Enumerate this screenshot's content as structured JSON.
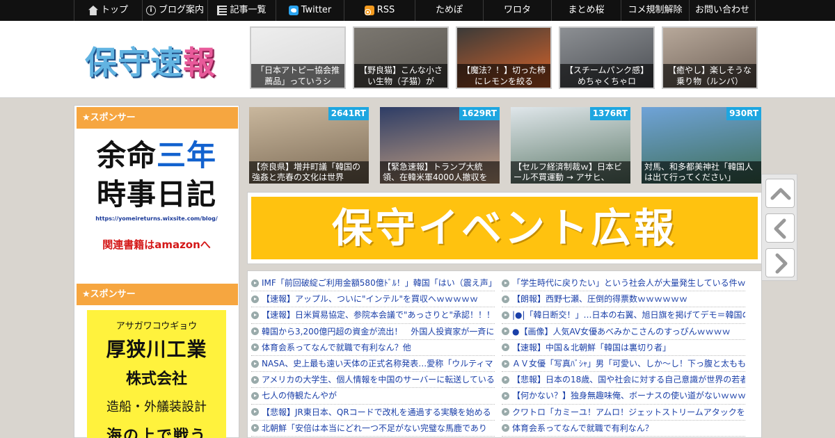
{
  "nav": {
    "items": [
      {
        "label": "トップ",
        "icon": "home-icon"
      },
      {
        "label": "ブログ案内",
        "icon": "info-icon"
      },
      {
        "label": "記事一覧",
        "icon": "list-icon"
      },
      {
        "label": "Twitter",
        "icon": "twitter-icon"
      },
      {
        "label": "RSS",
        "icon": "rss-icon"
      },
      {
        "label": "ためぽ",
        "icon": ""
      },
      {
        "label": "ワロタ",
        "icon": ""
      },
      {
        "label": "まとめ桜",
        "icon": ""
      },
      {
        "label": "コメ規制解除",
        "icon": ""
      },
      {
        "label": "お問い合わせ",
        "icon": ""
      }
    ]
  },
  "header": {
    "logo_part1": "保守",
    "logo_part2": "速",
    "logo_part3": "報",
    "thumbs": [
      {
        "caption": "「日本アトピー協会推薦品」っていうシ",
        "colors": [
          "#eeeeee",
          "#d8d8d8"
        ]
      },
      {
        "caption": "【野良猫】こんな小さい生物（子猫）が",
        "colors": [
          "#7b7770",
          "#5a5650"
        ]
      },
      {
        "caption": "【魔法？！】切った柿にレモンを絞る",
        "colors": [
          "#3b3a38",
          "#d9642a"
        ]
      },
      {
        "caption": "【スチームパンク感】めちゃくちゃロ",
        "colors": [
          "#8c8f93",
          "#4a4d52"
        ]
      },
      {
        "caption": "【癒やし】楽しそうな乗り物（ルンバ）",
        "colors": [
          "#b7a89a",
          "#6d5f55"
        ]
      }
    ]
  },
  "sidebar": {
    "sponsor_label_1": "★スポンサー",
    "sponsor_label_2": "★スポンサー",
    "ad1": {
      "line1a": "余命",
      "line1b": "三年",
      "line2": "時事日記",
      "url": "https://yomeireturns.wixsite.com/blog/",
      "link": "関連書籍はamazonへ"
    },
    "ad2": {
      "kana": "アサガワコウギョウ",
      "name": "厚狭川工業",
      "company": "株式会社",
      "desc": "造船・外艤装設計",
      "tag": "海の上で戦う"
    }
  },
  "ranking": [
    {
      "rt": "2641RT",
      "caption": "【奈良県】増井町議「韓国の強姦と売春の文化は世界",
      "colors": [
        "#c9b79d",
        "#7b6a55"
      ]
    },
    {
      "rt": "1629RT",
      "caption": "【緊急速報】トランプ大統領、在韓米軍4000人撤収を",
      "colors": [
        "#2e3d66",
        "#c9a382"
      ]
    },
    {
      "rt": "1376RT",
      "caption": "【セルフ経済制裁ｗ】日本ビール不買運動 → アサヒ、",
      "colors": [
        "#dfe6ea",
        "#5e7a6a"
      ]
    },
    {
      "rt": "930RT",
      "caption": "対馬、和多都美神社「韓国人は出て行ってください」",
      "colors": [
        "#6fa3d8",
        "#3e6d55"
      ]
    }
  ],
  "banner": {
    "text": "保守イベント広報",
    "color": "#ffc20f"
  },
  "links": {
    "left": [
      {
        "text": "IMF「前回破綻ご利用金額580億ﾄﾞﾙ！」韓国「はい（震え声」",
        "bullet": "arrow"
      },
      {
        "text": "【速報】アップル、ついに\"インテル\"を買収へｗｗｗｗｗ",
        "bullet": "arrow"
      },
      {
        "text": "【速報】日米貿易協定、参院本会議で\"あっさりと\"承認！！！",
        "bullet": "arrow"
      },
      {
        "text": "韓国から3,200億円超の資金が流出！　外国人投資家が一斉に逃",
        "bullet": "arrow"
      },
      {
        "text": "体育会系ってなんで就職で有利なん？他",
        "bullet": "arrow"
      },
      {
        "text": "NASA、史上最も遠い天体の正式名称発表…愛称「ウルティマ",
        "bullet": "arrow"
      },
      {
        "text": "アメリカの大学生、個人情報を中国のサーバーに転送している",
        "bullet": "arrow"
      },
      {
        "text": "七人の侍観たんやが",
        "bullet": "arrow"
      },
      {
        "text": "【悲報】JR東日本、QRコードで改札を通過する実験を始める",
        "bullet": "arrow"
      },
      {
        "text": "北朝鮮「安倍は本当にどれ一つ不足がない完璧な馬鹿であり",
        "bullet": "arrow"
      }
    ],
    "right": [
      {
        "text": "「学生時代に戻りたい」という社会人が大量発生している件ｗ",
        "bullet": "arrow"
      },
      {
        "text": "【朗報】西野七瀬、圧倒的得票数ｗｗｗｗｗｗ",
        "bullet": "arrow"
      },
      {
        "text": "|●|「韓日断交！」…日本の右翼、旭日旗を掲げてデモ＝韓国の",
        "bullet": "arrow"
      },
      {
        "text": "●【画像】人気AV女優あべみかこさんのすっぴんｗｗｗｗ",
        "bullet": "arrow"
      },
      {
        "text": "【速報】中国＆北朝鮮「韓国は裏切り者」",
        "bullet": "arrow"
      },
      {
        "text": "ＡＶ女優「写真ﾊﾞｼｬ」男「可愛い、しか～し！下っ腹と太もも",
        "bullet": "arrow"
      },
      {
        "text": "【悲報】日本の18歳、国や社会に対する自己意識が世界の若者",
        "bullet": "arrow"
      },
      {
        "text": "【何かない？】独身無趣味俺、ボーナスの使い道がないｗｗｗ",
        "bullet": "arrow"
      },
      {
        "text": "クワトロ「カミーユ！アムロ！ジェットストリームアタックを",
        "bullet": "arrow"
      },
      {
        "text": "体育会系ってなんで就職で有利なん？",
        "bullet": "arrow"
      }
    ]
  },
  "arrows": [
    "up-arrow-icon",
    "back-arrow-icon",
    "forward-arrow-icon"
  ]
}
